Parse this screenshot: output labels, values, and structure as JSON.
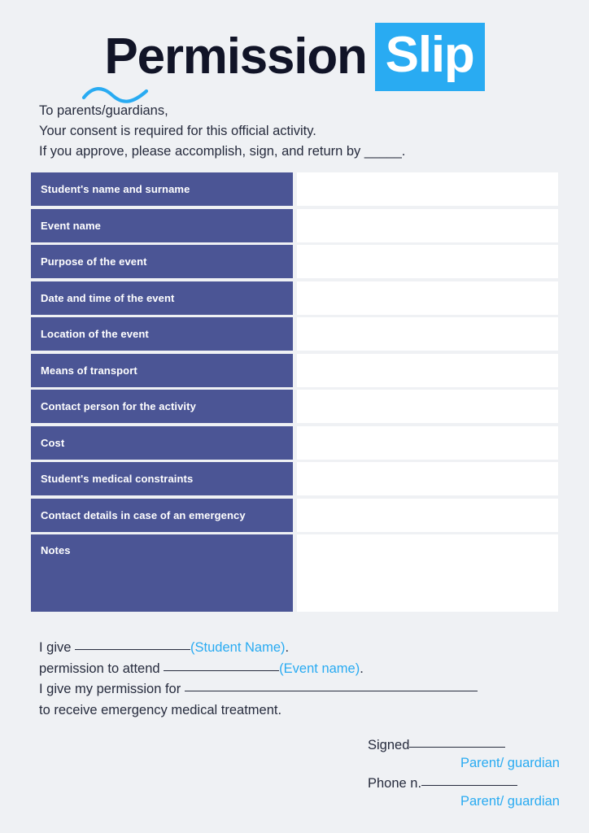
{
  "colors": {
    "page_background": "#eff1f4",
    "accent_blue": "#29abf2",
    "label_blue": "#4b5595",
    "text_dark": "#262b3d",
    "title_dark": "#111427",
    "value_cell": "#ffffff"
  },
  "header": {
    "title_part_one": "Permission",
    "title_part_two": "Slip"
  },
  "intro": {
    "line1": "To parents/guardians,",
    "line2": "Your consent is required for this official activity.",
    "line3": "If you approve, please accomplish, sign, and return by _____."
  },
  "table": {
    "rows": [
      {
        "label": "Student's name and surname",
        "value": ""
      },
      {
        "label": "Event name",
        "value": ""
      },
      {
        "label": "Purpose of the event",
        "value": ""
      },
      {
        "label": "Date and time of the event",
        "value": ""
      },
      {
        "label": "Location of the event",
        "value": ""
      },
      {
        "label": "Means of transport",
        "value": ""
      },
      {
        "label": "Contact person for the activity",
        "value": ""
      },
      {
        "label": "Cost",
        "value": ""
      },
      {
        "label": "Student's medical constraints",
        "value": ""
      },
      {
        "label": "Contact details in case of an emergency",
        "value": ""
      },
      {
        "label": "Notes",
        "value": ""
      }
    ]
  },
  "consent": {
    "line1_prefix": "I give ",
    "line1_hint": "(Student Name)",
    "line1_suffix": ".",
    "line2_prefix": "permission to attend ",
    "line2_hint": "(Event name)",
    "line2_suffix": ".",
    "line3_prefix": "I give my permission for ",
    "line4": "to receive emergency medical treatment."
  },
  "signature": {
    "signed_label": "Signed",
    "signed_caption": "Parent/ guardian",
    "phone_label": "Phone n.",
    "phone_caption": "Parent/ guardian"
  }
}
